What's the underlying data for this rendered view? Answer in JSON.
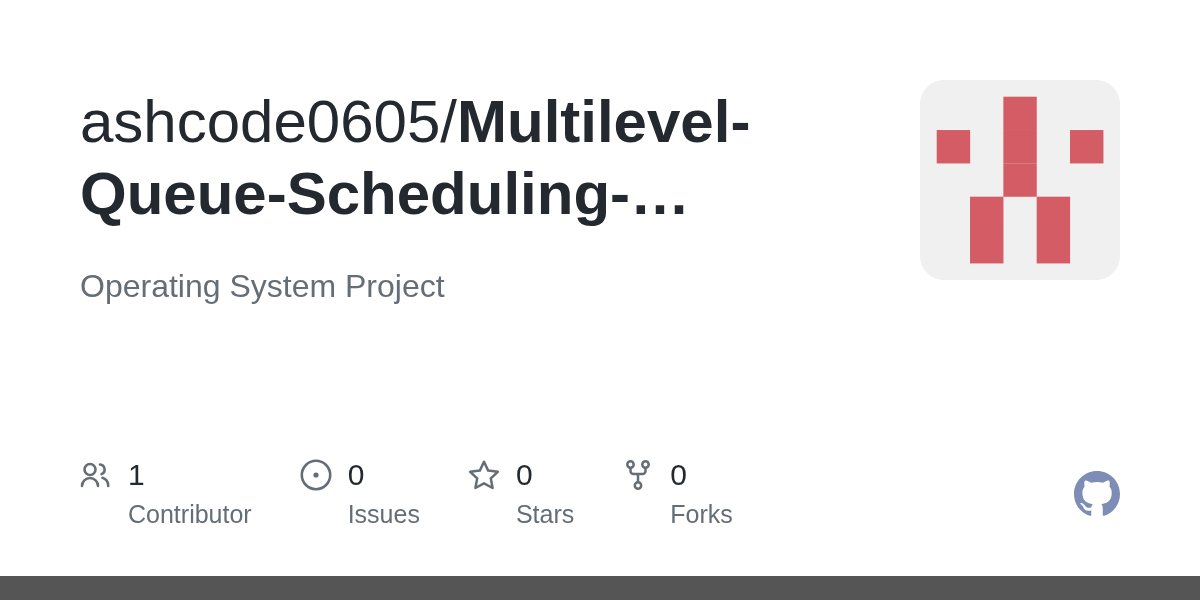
{
  "repo": {
    "title": "ashcode0605/**Multilevel-Queue-Scheduling-…**",
    "description": "Operating System Project"
  },
  "stats": [
    {
      "kind": "contributors",
      "value": "1",
      "label": "Contributor"
    },
    {
      "kind": "issues",
      "value": "0",
      "label": "Issues"
    },
    {
      "kind": "stars",
      "value": "0",
      "label": "Stars"
    },
    {
      "kind": "forks",
      "value": "0",
      "label": "Forks"
    }
  ]
}
